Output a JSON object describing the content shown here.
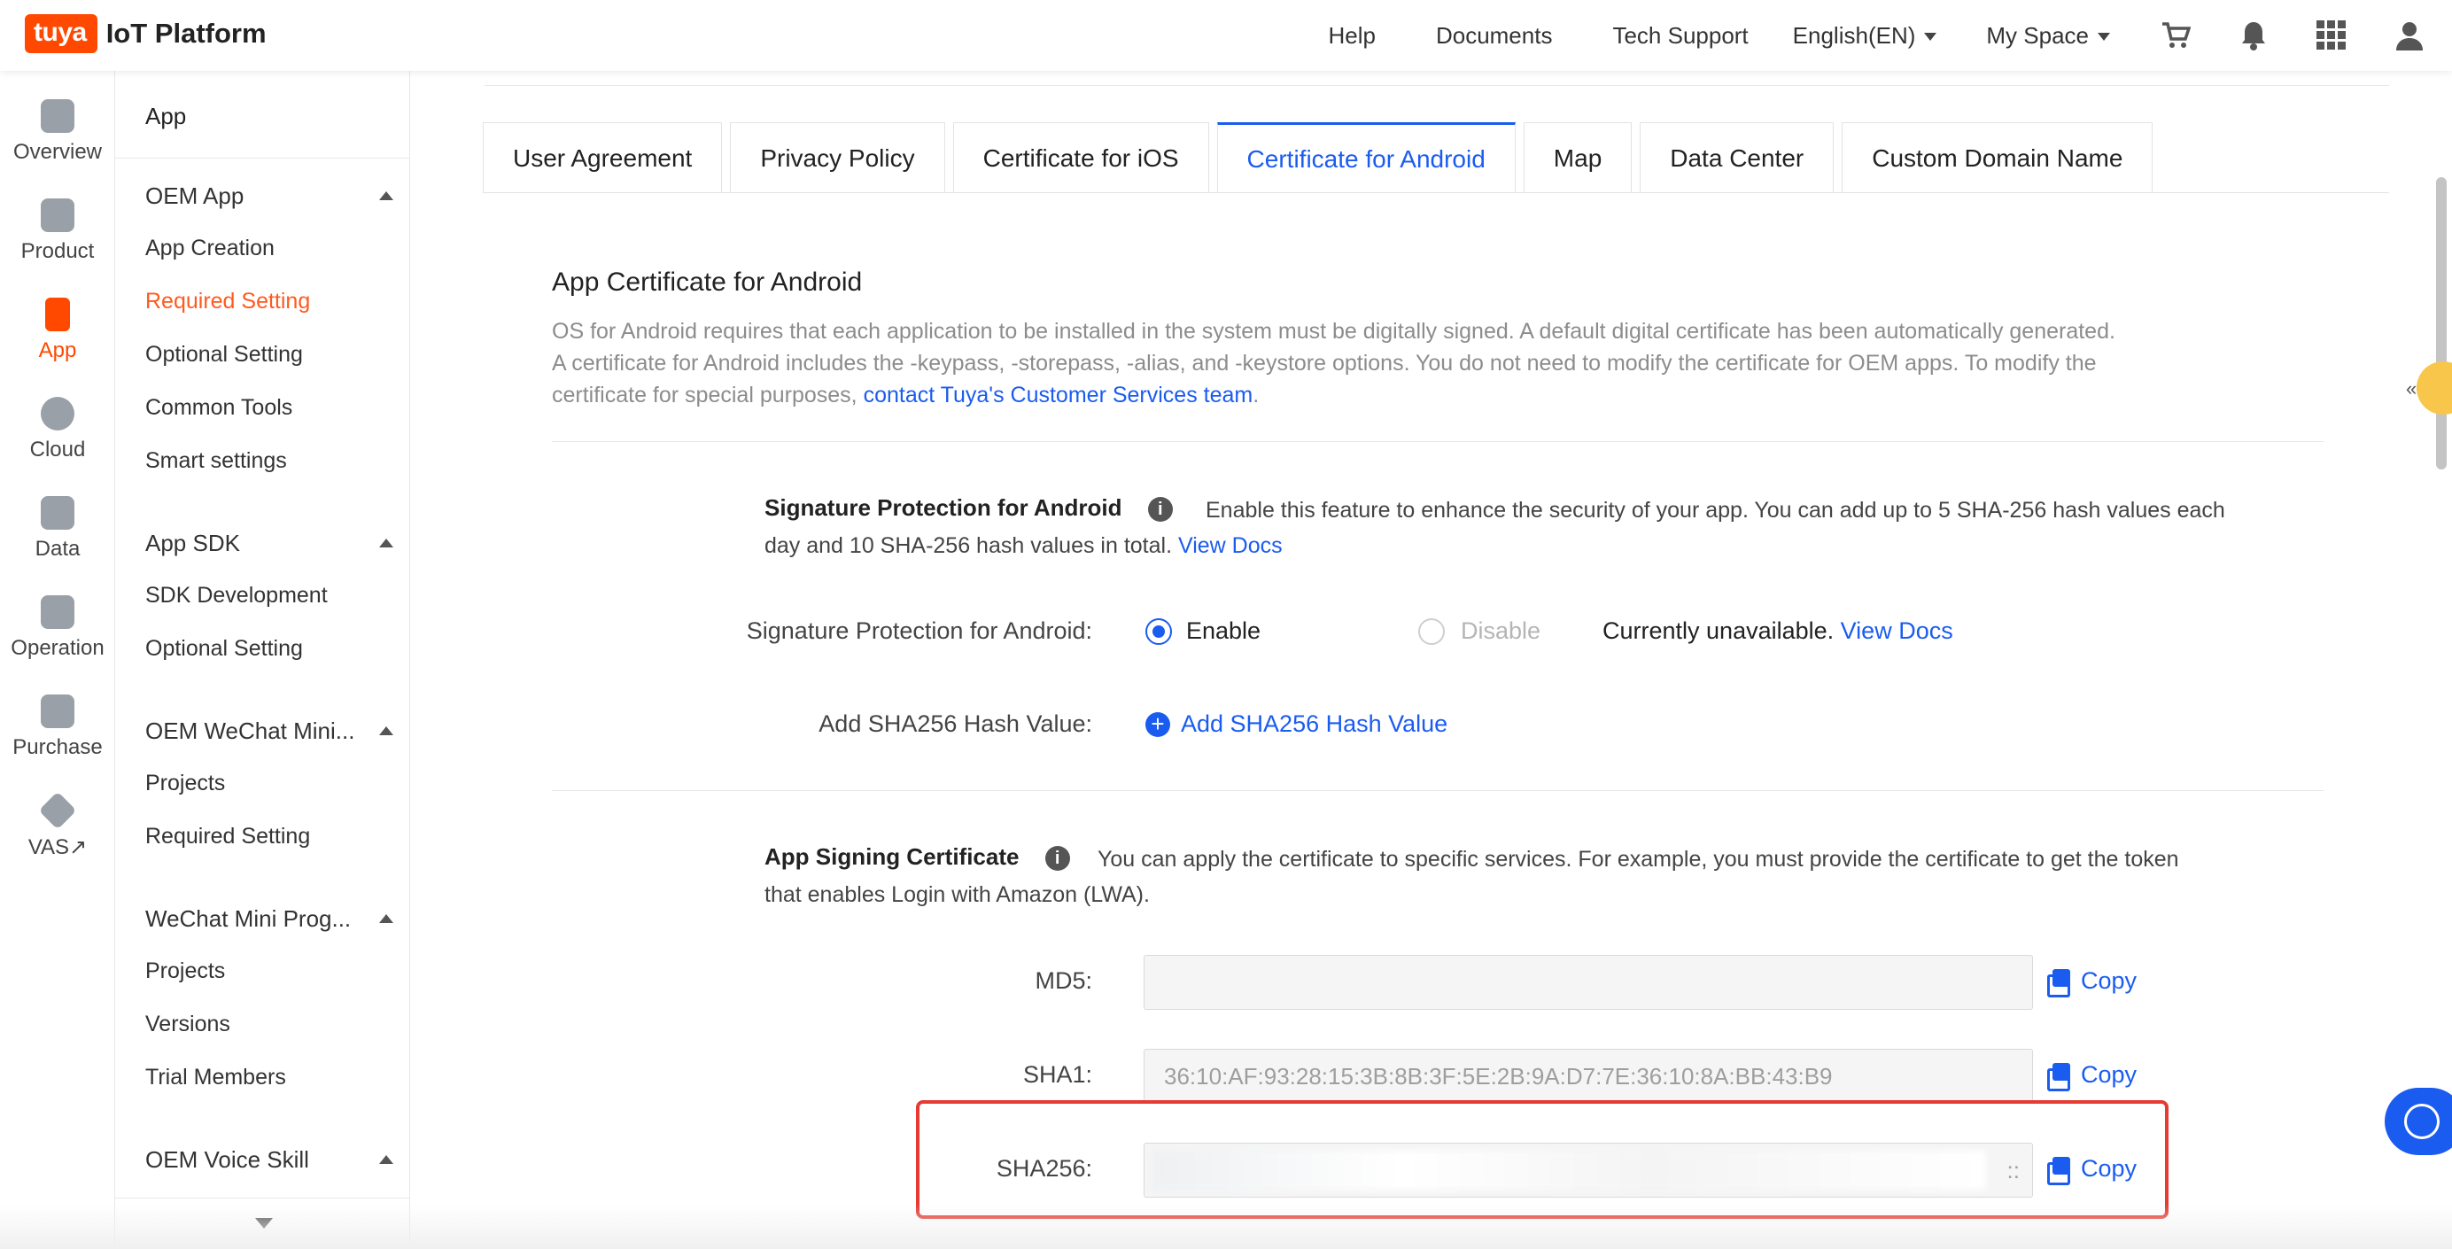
{
  "header": {
    "logo_badge": "tuya",
    "logo_text": "IoT Platform",
    "nav": [
      "Help",
      "Documents",
      "Tech Support"
    ],
    "language": "English(EN)",
    "space": "My Space",
    "icons": [
      "cart-icon",
      "bell-icon",
      "apps-grid-icon",
      "user-icon"
    ]
  },
  "rail": {
    "items": [
      {
        "label": "Overview",
        "icon": "home-icon"
      },
      {
        "label": "Product",
        "icon": "terminal-icon"
      },
      {
        "label": "App",
        "icon": "phone-icon"
      },
      {
        "label": "Cloud",
        "icon": "cloud-icon"
      },
      {
        "label": "Data",
        "icon": "chart-icon"
      },
      {
        "label": "Operation",
        "icon": "star-tag-icon"
      },
      {
        "label": "Purchase",
        "icon": "box-icon"
      },
      {
        "label": "VAS↗",
        "icon": "diamond-icon"
      }
    ],
    "active": "App"
  },
  "subnav": {
    "title": "App",
    "groups": [
      {
        "label": "OEM App",
        "items": [
          "App Creation",
          "Required Setting",
          "Optional Setting",
          "Common Tools",
          "Smart settings"
        ]
      },
      {
        "label": "App SDK",
        "items": [
          "SDK Development",
          "Optional Setting"
        ]
      },
      {
        "label": "OEM WeChat Mini...",
        "items": [
          "Projects",
          "Required Setting"
        ]
      },
      {
        "label": "WeChat Mini Prog...",
        "items": [
          "Projects",
          "Versions",
          "Trial Members"
        ]
      },
      {
        "label": "OEM Voice Skill",
        "items": []
      }
    ],
    "active_item": "Required Setting"
  },
  "tabs": [
    "User Agreement",
    "Privacy Policy",
    "Certificate for iOS",
    "Certificate for Android",
    "Map",
    "Data Center",
    "Custom Domain Name"
  ],
  "active_tab": "Certificate for Android",
  "section": {
    "title": "App Certificate for Android",
    "desc_1": "OS for Android requires that each application to be installed in the system must be digitally signed. A default digital certificate has been automatically generated.",
    "desc_2": "A certificate for Android includes the -keypass, -storepass, -alias, and -keystore options. You do not need to modify the certificate for OEM apps. To modify the",
    "desc_3": "certificate for special purposes, ",
    "desc_link": "contact Tuya's Customer Services team",
    "desc_end": "."
  },
  "sigprot": {
    "heading": "Signature Protection for Android",
    "desc_1": "Enable this feature to enhance the security of your app. You can add up to 5 SHA-256 hash values each",
    "desc_2": "day and 10 SHA-256 hash values in total. ",
    "docs_link": "View Docs",
    "field_label": "Signature Protection for Android:",
    "enable": "Enable",
    "disable": "Disable",
    "unavailable": "Currently unavailable. ",
    "unavailable_link": "View Docs",
    "add_label": "Add SHA256 Hash Value:",
    "add_button": "Add SHA256 Hash Value"
  },
  "signing": {
    "heading": "App Signing Certificate",
    "desc_1": "You can apply the certificate to specific services. For example, you must provide the certificate to get the token",
    "desc_2": "that enables Login with Amazon (LWA).",
    "md5_label": "MD5:",
    "md5_value": "",
    "sha1_label": "SHA1:",
    "sha1_value": "36:10:AF:93:28:15:3B:8B:3F:5E:2B:9A:D7:7E:36:10:8A:BB:43:B9",
    "sha256_label": "SHA256:",
    "sha256_tail": "::",
    "copy": "Copy"
  },
  "colors": {
    "brand": "#ff4800",
    "link": "#1a5cf0",
    "highlight": "#e53b32"
  }
}
